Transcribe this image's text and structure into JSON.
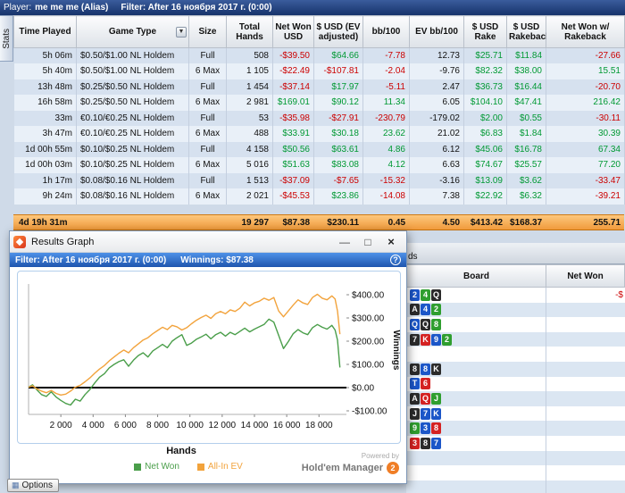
{
  "header": {
    "player_label": "Player:",
    "player_name": "me me me  (Alias)",
    "filter_text": "Filter: After 16 ноября 2017 г. (0:00)"
  },
  "sidebar": {
    "stats_tab": "Stats"
  },
  "table": {
    "columns": [
      {
        "label": "Time Played"
      },
      {
        "label": "Game Type",
        "dropdown": true
      },
      {
        "label": "Size"
      },
      {
        "label": "Total Hands"
      },
      {
        "label": "Net Won USD"
      },
      {
        "label": "$ USD (EV adjusted)"
      },
      {
        "label": "bb/100"
      },
      {
        "label": "EV bb/100"
      },
      {
        "label": "$ USD Rake"
      },
      {
        "label": "$ USD Rakeback"
      },
      {
        "label": "Net Won w/ Rakeback"
      }
    ],
    "rows": [
      {
        "time": "5h 06m",
        "game": "$0.50/$1.00 NL Holdem",
        "size": "Full",
        "hands": "508",
        "net_won": "-$39.50",
        "ev_adj": "$64.66",
        "bb100": "-7.78",
        "ev_bb100": "12.73",
        "rake": "$25.71",
        "rakeback": "$11.84",
        "net_rb": "-27.66"
      },
      {
        "time": "5h 40m",
        "game": "$0.50/$1.00 NL Holdem",
        "size": "6 Max",
        "hands": "1 105",
        "net_won": "-$22.49",
        "ev_adj": "-$107.81",
        "bb100": "-2.04",
        "ev_bb100": "-9.76",
        "rake": "$82.32",
        "rakeback": "$38.00",
        "net_rb": "15.51"
      },
      {
        "time": "13h 48m",
        "game": "$0.25/$0.50 NL Holdem",
        "size": "Full",
        "hands": "1 454",
        "net_won": "-$37.14",
        "ev_adj": "$17.97",
        "bb100": "-5.11",
        "ev_bb100": "2.47",
        "rake": "$36.73",
        "rakeback": "$16.44",
        "net_rb": "-20.70"
      },
      {
        "time": "16h 58m",
        "game": "$0.25/$0.50 NL Holdem",
        "size": "6 Max",
        "hands": "2 981",
        "net_won": "$169.01",
        "ev_adj": "$90.12",
        "bb100": "11.34",
        "ev_bb100": "6.05",
        "rake": "$104.10",
        "rakeback": "$47.41",
        "net_rb": "216.42"
      },
      {
        "time": "33m",
        "game": "€0.10/€0.25 NL Holdem",
        "size": "Full",
        "hands": "53",
        "net_won": "-$35.98",
        "ev_adj": "-$27.91",
        "bb100": "-230.79",
        "ev_bb100": "-179.02",
        "rake": "$2.00",
        "rakeback": "$0.55",
        "net_rb": "-30.11"
      },
      {
        "time": "3h 47m",
        "game": "€0.10/€0.25 NL Holdem",
        "size": "6 Max",
        "hands": "488",
        "net_won": "$33.91",
        "ev_adj": "$30.18",
        "bb100": "23.62",
        "ev_bb100": "21.02",
        "rake": "$6.83",
        "rakeback": "$1.84",
        "net_rb": "30.39"
      },
      {
        "time": "1d 00h 55m",
        "game": "$0.10/$0.25 NL Holdem",
        "size": "Full",
        "hands": "4 158",
        "net_won": "$50.56",
        "ev_adj": "$63.61",
        "bb100": "4.86",
        "ev_bb100": "6.12",
        "rake": "$45.06",
        "rakeback": "$16.78",
        "net_rb": "67.34"
      },
      {
        "time": "1d 00h 03m",
        "game": "$0.10/$0.25 NL Holdem",
        "size": "6 Max",
        "hands": "5 016",
        "net_won": "$51.63",
        "ev_adj": "$83.08",
        "bb100": "4.12",
        "ev_bb100": "6.63",
        "rake": "$74.67",
        "rakeback": "$25.57",
        "net_rb": "77.20"
      },
      {
        "time": "1h 17m",
        "game": "$0.08/$0.16 NL Holdem",
        "size": "Full",
        "hands": "1 513",
        "net_won": "-$37.09",
        "ev_adj": "-$7.65",
        "bb100": "-15.32",
        "ev_bb100": "-3.16",
        "rake": "$13.09",
        "rakeback": "$3.62",
        "net_rb": "-33.47"
      },
      {
        "time": "9h 24m",
        "game": "$0.08/$0.16 NL Holdem",
        "size": "6 Max",
        "hands": "2 021",
        "net_won": "-$45.53",
        "ev_adj": "$23.86",
        "bb100": "-14.08",
        "ev_bb100": "7.38",
        "rake": "$22.92",
        "rakeback": "$6.32",
        "net_rb": "-39.21"
      }
    ],
    "totals": {
      "time": "4d 19h 31m",
      "hands": "19 297",
      "net_won": "$87.38",
      "ev_adj": "$230.11",
      "bb100": "0.45",
      "ev_bb100": "4.50",
      "rake": "$413.42",
      "rakeback": "$168.37",
      "net_rb": "255.71"
    }
  },
  "results_window": {
    "title": "Results Graph",
    "filter_text": "Filter: After 16 ноября 2017 г. (0:00)",
    "winnings_text": "Winnings: $87.38",
    "help_glyph": "?",
    "controls": {
      "minimize": "—",
      "maximize": "□",
      "close": "×"
    },
    "powered_by": "Powered by",
    "brand": "Hold'em Manager",
    "brand_badge": "2"
  },
  "chart_data": {
    "type": "line",
    "title": "",
    "xlabel": "Hands",
    "ylabel": "Winnings",
    "xlim": [
      0,
      19700
    ],
    "ylim": [
      -150,
      470
    ],
    "grid": false,
    "zero_line": true,
    "legend_position": "bottom",
    "x_ticks": [
      2000,
      4000,
      6000,
      8000,
      10000,
      12000,
      14000,
      16000,
      18000
    ],
    "x_tick_labels": [
      "2 000",
      "4 000",
      "6 000",
      "8 000",
      "10 000",
      "12 000",
      "14 000",
      "16 000",
      "18 000"
    ],
    "y_ticks": [
      400,
      300,
      200,
      100,
      0,
      -100
    ],
    "y_tick_labels": [
      "$400.00",
      "$300.00",
      "$200.00",
      "$100.00",
      "$0.00",
      "-$100.00"
    ],
    "series": [
      {
        "name": "Net Won",
        "color": "#4a9e4a",
        "points": [
          [
            0,
            2
          ],
          [
            250,
            12
          ],
          [
            500,
            -8
          ],
          [
            800,
            -30
          ],
          [
            1100,
            -38
          ],
          [
            1400,
            -18
          ],
          [
            1700,
            -40
          ],
          [
            2000,
            -55
          ],
          [
            2300,
            -68
          ],
          [
            2600,
            -75
          ],
          [
            2900,
            -50
          ],
          [
            3200,
            -58
          ],
          [
            3500,
            -30
          ],
          [
            3800,
            -8
          ],
          [
            4100,
            20
          ],
          [
            4400,
            45
          ],
          [
            4700,
            60
          ],
          [
            5000,
            85
          ],
          [
            5300,
            100
          ],
          [
            5600,
            112
          ],
          [
            5900,
            120
          ],
          [
            6200,
            92
          ],
          [
            6500,
            118
          ],
          [
            6800,
            138
          ],
          [
            7100,
            150
          ],
          [
            7400,
            132
          ],
          [
            7700,
            158
          ],
          [
            8000,
            172
          ],
          [
            8300,
            186
          ],
          [
            8600,
            172
          ],
          [
            8900,
            200
          ],
          [
            9200,
            215
          ],
          [
            9500,
            228
          ],
          [
            9800,
            182
          ],
          [
            10100,
            192
          ],
          [
            10400,
            208
          ],
          [
            10700,
            218
          ],
          [
            11000,
            230
          ],
          [
            11300,
            210
          ],
          [
            11600,
            228
          ],
          [
            11900,
            238
          ],
          [
            12200,
            222
          ],
          [
            12500,
            238
          ],
          [
            12800,
            228
          ],
          [
            13100,
            242
          ],
          [
            13400,
            256
          ],
          [
            13700,
            240
          ],
          [
            14000,
            252
          ],
          [
            14300,
            262
          ],
          [
            14600,
            272
          ],
          [
            14900,
            295
          ],
          [
            15200,
            282
          ],
          [
            15500,
            225
          ],
          [
            15800,
            168
          ],
          [
            16100,
            198
          ],
          [
            16400,
            232
          ],
          [
            16700,
            250
          ],
          [
            17000,
            236
          ],
          [
            17300,
            228
          ],
          [
            17600,
            258
          ],
          [
            17900,
            272
          ],
          [
            18200,
            260
          ],
          [
            18500,
            252
          ],
          [
            18800,
            268
          ],
          [
            19000,
            248
          ],
          [
            19150,
            205
          ],
          [
            19297,
            87
          ]
        ]
      },
      {
        "name": "All-In EV",
        "color": "#f2a33c",
        "points": [
          [
            0,
            2
          ],
          [
            250,
            8
          ],
          [
            500,
            -5
          ],
          [
            800,
            -15
          ],
          [
            1100,
            -22
          ],
          [
            1400,
            -12
          ],
          [
            1700,
            -25
          ],
          [
            2000,
            -32
          ],
          [
            2300,
            -28
          ],
          [
            2600,
            -15
          ],
          [
            2900,
            2
          ],
          [
            3200,
            10
          ],
          [
            3500,
            25
          ],
          [
            3800,
            42
          ],
          [
            4100,
            62
          ],
          [
            4400,
            80
          ],
          [
            4700,
            95
          ],
          [
            5000,
            115
          ],
          [
            5300,
            132
          ],
          [
            5600,
            148
          ],
          [
            5900,
            162
          ],
          [
            6200,
            150
          ],
          [
            6500,
            172
          ],
          [
            6800,
            188
          ],
          [
            7100,
            205
          ],
          [
            7400,
            215
          ],
          [
            7700,
            232
          ],
          [
            8000,
            246
          ],
          [
            8300,
            260
          ],
          [
            8600,
            250
          ],
          [
            8900,
            268
          ],
          [
            9200,
            262
          ],
          [
            9500,
            248
          ],
          [
            9800,
            258
          ],
          [
            10100,
            275
          ],
          [
            10400,
            290
          ],
          [
            10700,
            302
          ],
          [
            11000,
            312
          ],
          [
            11300,
            298
          ],
          [
            11600,
            318
          ],
          [
            11900,
            328
          ],
          [
            12200,
            318
          ],
          [
            12500,
            335
          ],
          [
            12800,
            328
          ],
          [
            13100,
            342
          ],
          [
            13400,
            368
          ],
          [
            13700,
            352
          ],
          [
            14000,
            365
          ],
          [
            14300,
            372
          ],
          [
            14600,
            385
          ],
          [
            14900,
            376
          ],
          [
            15200,
            388
          ],
          [
            15500,
            330
          ],
          [
            15800,
            305
          ],
          [
            16100,
            330
          ],
          [
            16400,
            355
          ],
          [
            16700,
            378
          ],
          [
            17000,
            365
          ],
          [
            17300,
            358
          ],
          [
            17600,
            388
          ],
          [
            17900,
            402
          ],
          [
            18200,
            385
          ],
          [
            18500,
            378
          ],
          [
            18800,
            395
          ],
          [
            19000,
            382
          ],
          [
            19150,
            330
          ],
          [
            19297,
            230
          ]
        ]
      }
    ]
  },
  "right_panel": {
    "tab_fragment": "ds",
    "columns": [
      "Board",
      "Net Won"
    ],
    "rows": [
      {
        "cards": [
          [
            "2",
            "d"
          ],
          [
            "4",
            "c"
          ],
          [
            "Q",
            "s"
          ]
        ],
        "net_won": "-$"
      },
      {
        "cards": [
          [
            "A",
            "s"
          ],
          [
            "4",
            "d"
          ],
          [
            "2",
            "c"
          ]
        ]
      },
      {
        "cards": [
          [
            "Q",
            "d"
          ],
          [
            "Q",
            "s"
          ],
          [
            "8",
            "c"
          ]
        ]
      },
      {
        "cards": [
          [
            "7",
            "s"
          ],
          [
            "K",
            "h"
          ],
          [
            "9",
            "d"
          ],
          [
            "2",
            "c"
          ]
        ]
      },
      {
        "cards": []
      },
      {
        "cards": [
          [
            "8",
            "s"
          ],
          [
            "8",
            "d"
          ],
          [
            "K",
            "s"
          ]
        ]
      },
      {
        "cards": [
          [
            "T",
            "d"
          ],
          [
            "6",
            "h"
          ]
        ]
      },
      {
        "cards": [
          [
            "A",
            "s"
          ],
          [
            "Q",
            "h"
          ],
          [
            "J",
            "c"
          ]
        ]
      },
      {
        "cards": [
          [
            "J",
            "s"
          ],
          [
            "7",
            "d"
          ],
          [
            "K",
            "d"
          ]
        ]
      },
      {
        "cards": [
          [
            "9",
            "c"
          ],
          [
            "3",
            "d"
          ],
          [
            "8",
            "h"
          ]
        ]
      },
      {
        "cards": [
          [
            "3",
            "h"
          ],
          [
            "8",
            "s"
          ],
          [
            "7",
            "d"
          ]
        ]
      },
      {
        "cards": []
      },
      {
        "cards": []
      },
      {
        "cards": []
      }
    ]
  },
  "options_button": {
    "label": "Options",
    "icon": "▦"
  }
}
